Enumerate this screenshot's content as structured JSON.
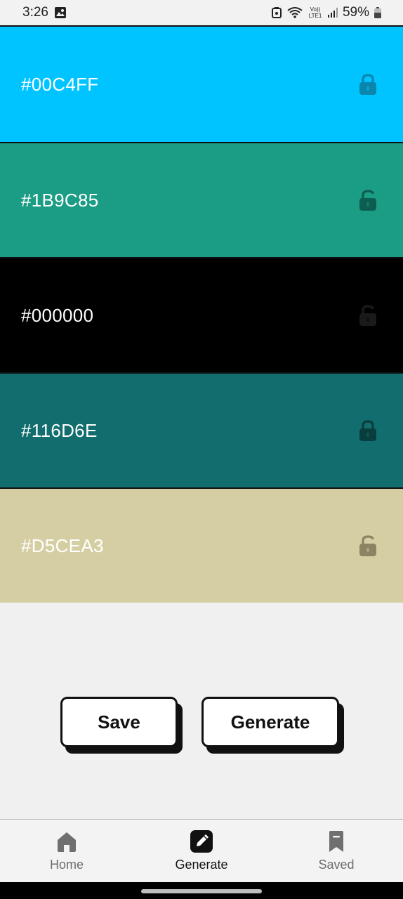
{
  "status_bar": {
    "time": "3:26",
    "battery": "59%",
    "icons": [
      "gallery-icon",
      "cast-icon",
      "wifi-icon",
      "volte-icon",
      "signal-icon",
      "battery-icon"
    ],
    "volte_label": "Vo)) LTE1"
  },
  "palette": [
    {
      "hex": "#00C4FF",
      "color": "#00C4FF",
      "locked": true,
      "lock_color": "#0a86ad"
    },
    {
      "hex": "#1B9C85",
      "color": "#1B9C85",
      "locked": false,
      "lock_color": "#0d5d50"
    },
    {
      "hex": "#000000",
      "color": "#000000",
      "locked": false,
      "lock_color": "#1a1a1a"
    },
    {
      "hex": "#116D6E",
      "color": "#116D6E",
      "locked": true,
      "lock_color": "#0a3d3e"
    },
    {
      "hex": "#D5CEA3",
      "color": "#D5CEA3",
      "locked": false,
      "lock_color": "#8a8465"
    }
  ],
  "actions": {
    "save_label": "Save",
    "generate_label": "Generate"
  },
  "bottom_nav": {
    "items": [
      {
        "label": "Home",
        "icon": "home-icon",
        "active": false
      },
      {
        "label": "Generate",
        "icon": "pencil-icon",
        "active": true
      },
      {
        "label": "Saved",
        "icon": "bookmark-icon",
        "active": false
      }
    ]
  }
}
